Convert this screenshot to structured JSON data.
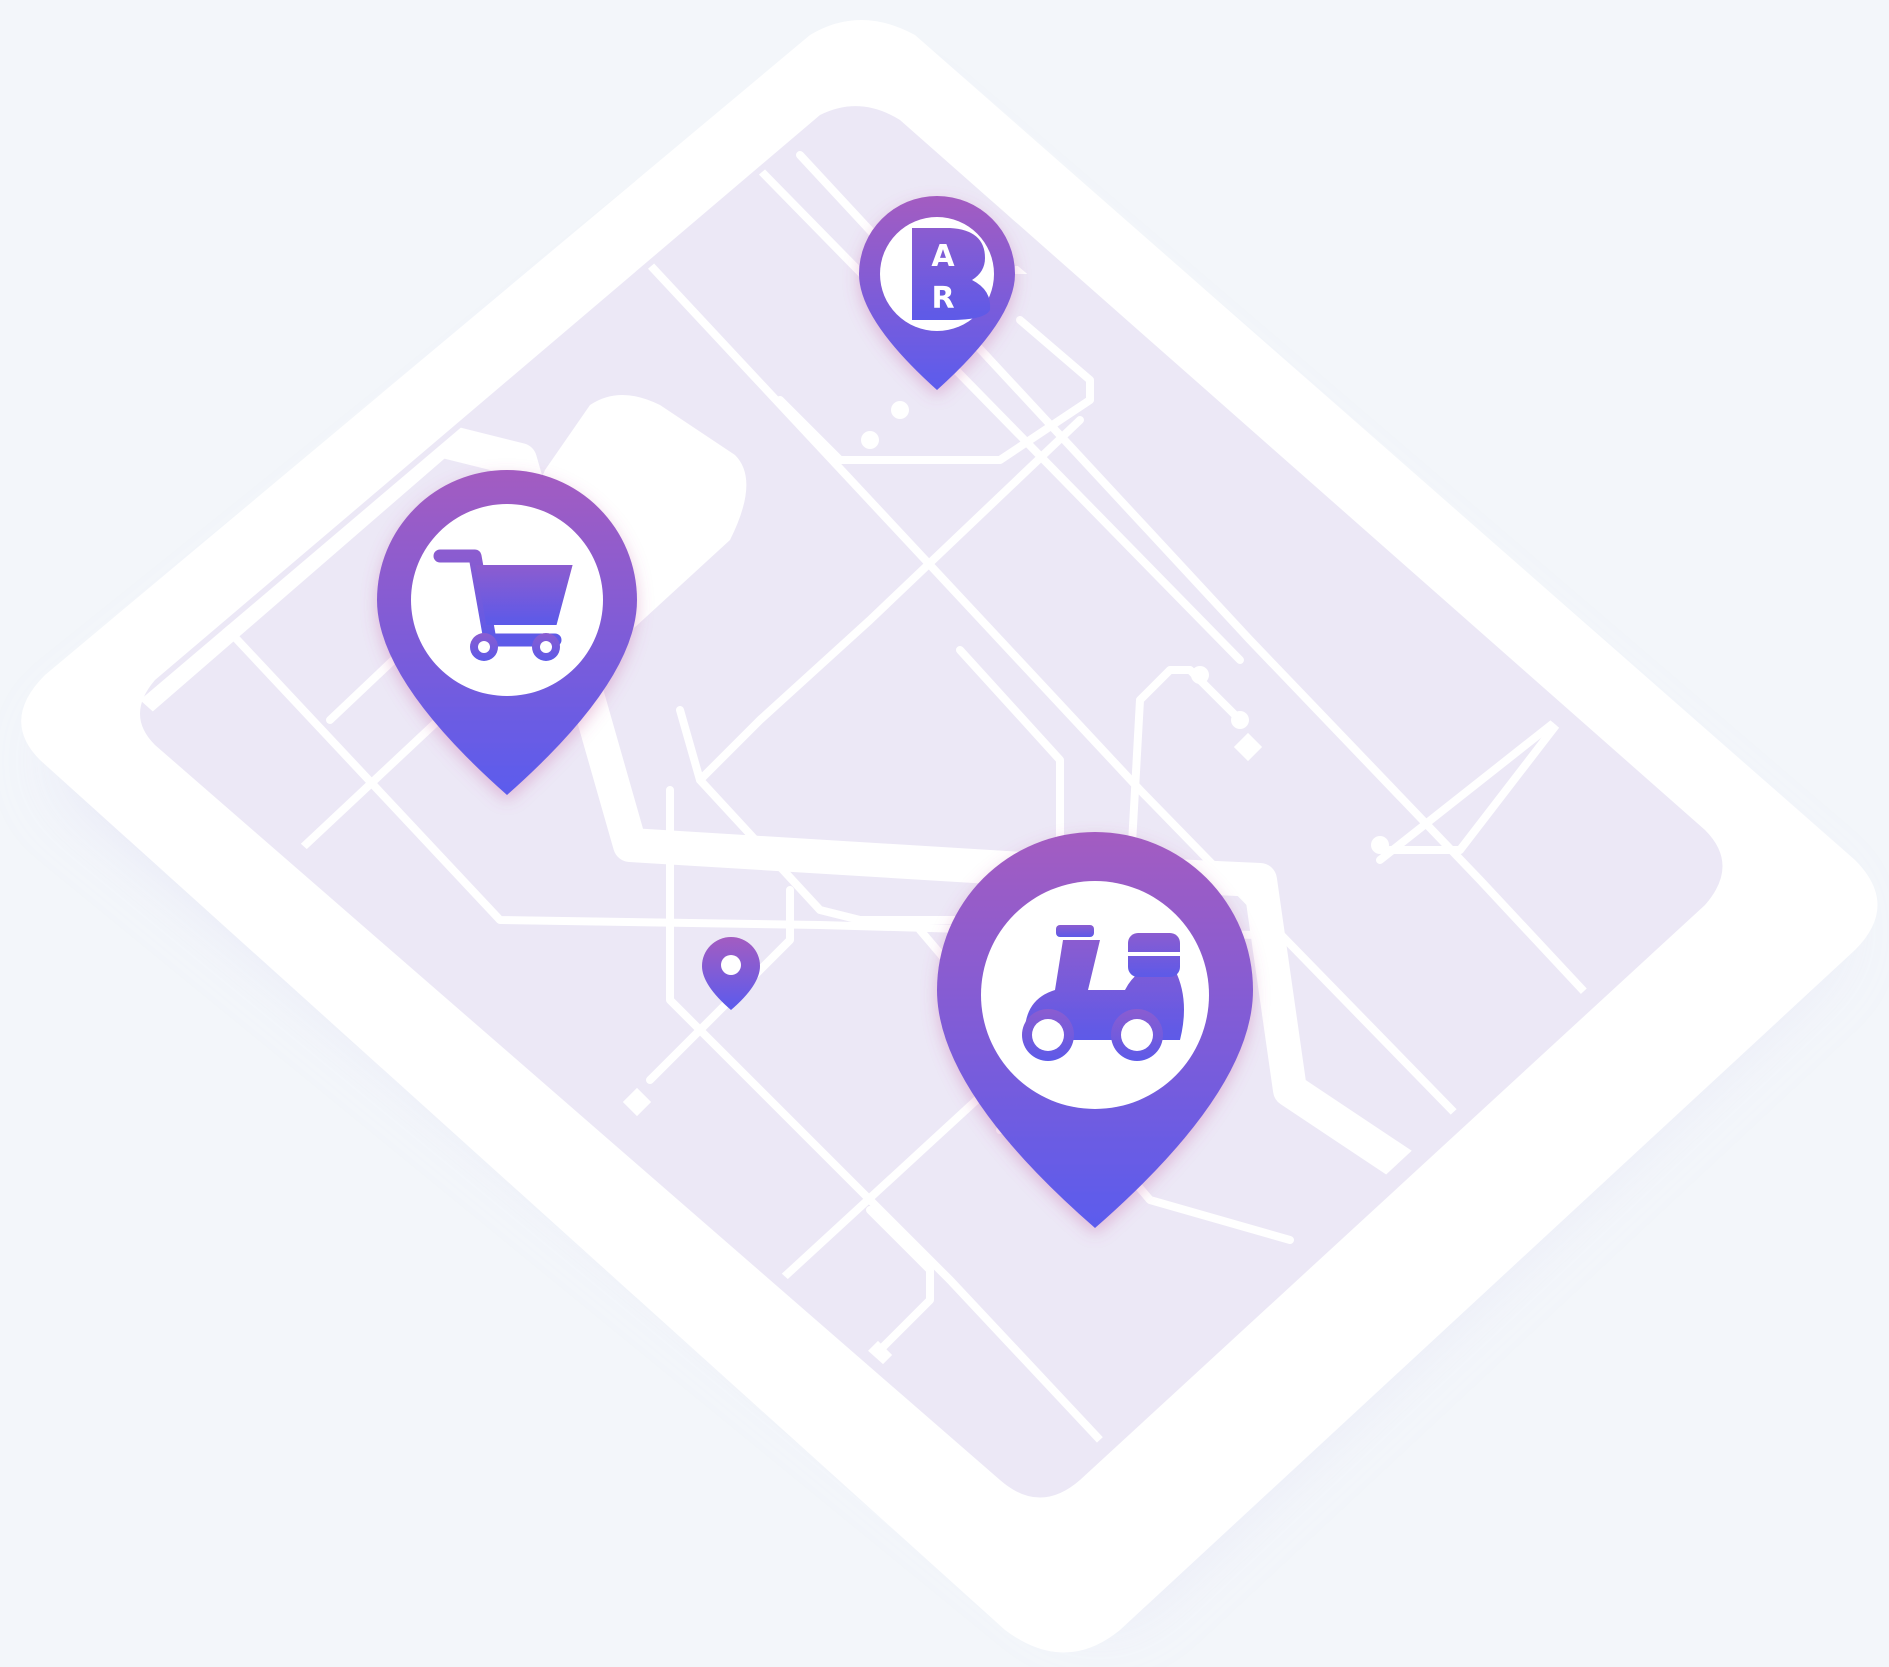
{
  "colors": {
    "background": "#f3f6fa",
    "device_frame": "#ffffff",
    "map_fill": "#ece8f6",
    "road": "#ffffff",
    "pin_gradient_top": "#a35cc1",
    "pin_gradient_bottom": "#5b5bed",
    "pin_icon": "#6a58dc",
    "shadow": "#c7c3ef"
  },
  "pins": [
    {
      "id": "bar",
      "icon": "bar-logo-icon",
      "letter_top": "A",
      "letter_bottom": "R"
    },
    {
      "id": "shopping",
      "icon": "shopping-cart-icon"
    },
    {
      "id": "delivery",
      "icon": "delivery-scooter-icon"
    },
    {
      "id": "location",
      "icon": "location-dot-icon"
    }
  ]
}
